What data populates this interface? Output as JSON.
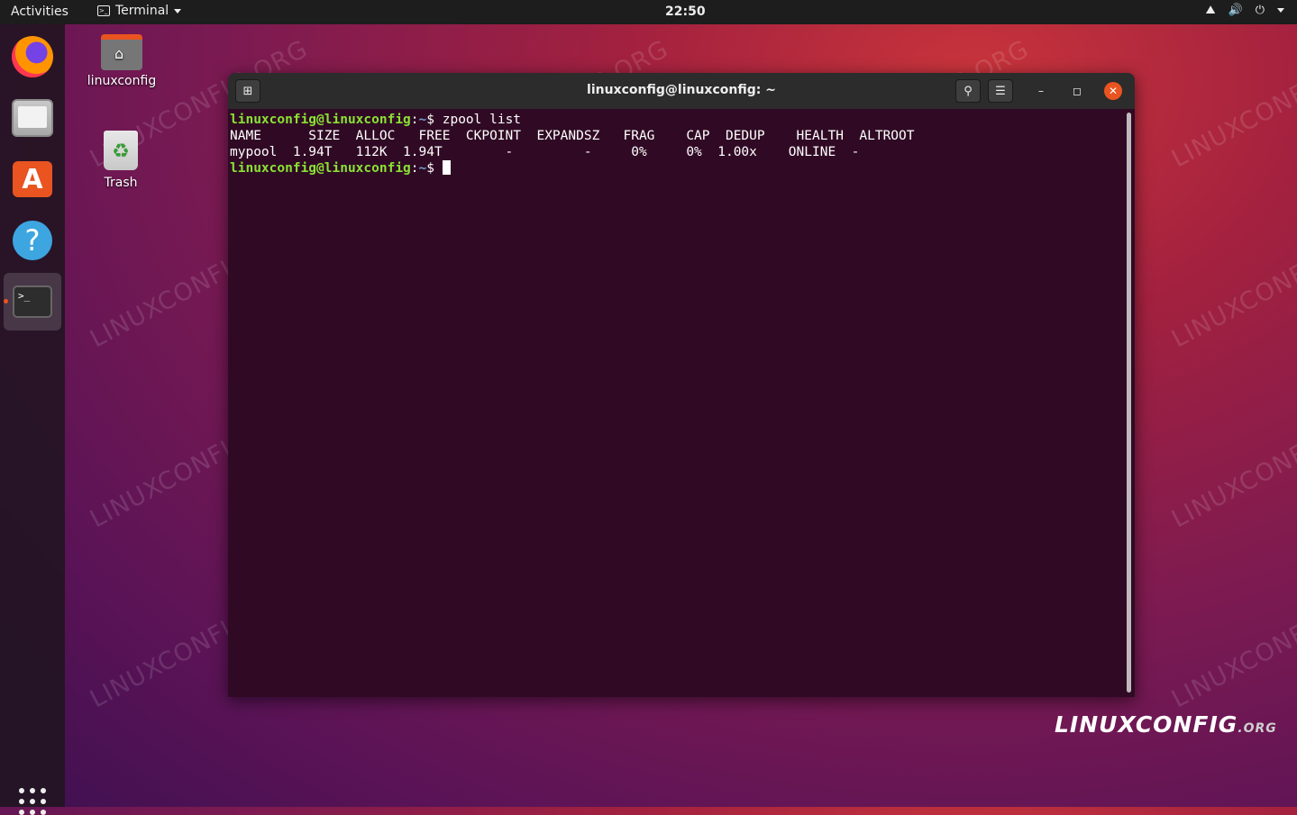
{
  "topbar": {
    "activities": "Activities",
    "app_name": "Terminal",
    "clock": "22:50",
    "tray_icons": [
      "network-icon",
      "volume-icon",
      "power-icon",
      "chevron-down-icon"
    ]
  },
  "dock": {
    "items": [
      "firefox-icon",
      "files-icon",
      "software-icon",
      "help-icon",
      "terminal-icon"
    ],
    "active": "terminal-icon"
  },
  "desktop": {
    "home_label": "linuxconfig",
    "trash_label": "Trash",
    "watermark": "LINUXCONFIG.ORG",
    "logo_main": "LINUXCONFIG",
    "logo_suffix": ".ORG"
  },
  "terminal": {
    "title": "linuxconfig@linuxconfig: ~",
    "prompt_user": "linuxconfig@linuxconfig",
    "prompt_path": "~",
    "prompt_symbol": "$",
    "command": "zpool list",
    "output_header": "NAME      SIZE  ALLOC   FREE  CKPOINT  EXPANDSZ   FRAG    CAP  DEDUP    HEALTH  ALTROOT",
    "output_row": "mypool  1.94T   112K  1.94T        -         -     0%     0%  1.00x    ONLINE  -"
  },
  "colors": {
    "accent": "#e95420",
    "terminal_bg": "#300a24",
    "prompt_user": "#8ae234",
    "prompt_path": "#729fcf"
  }
}
